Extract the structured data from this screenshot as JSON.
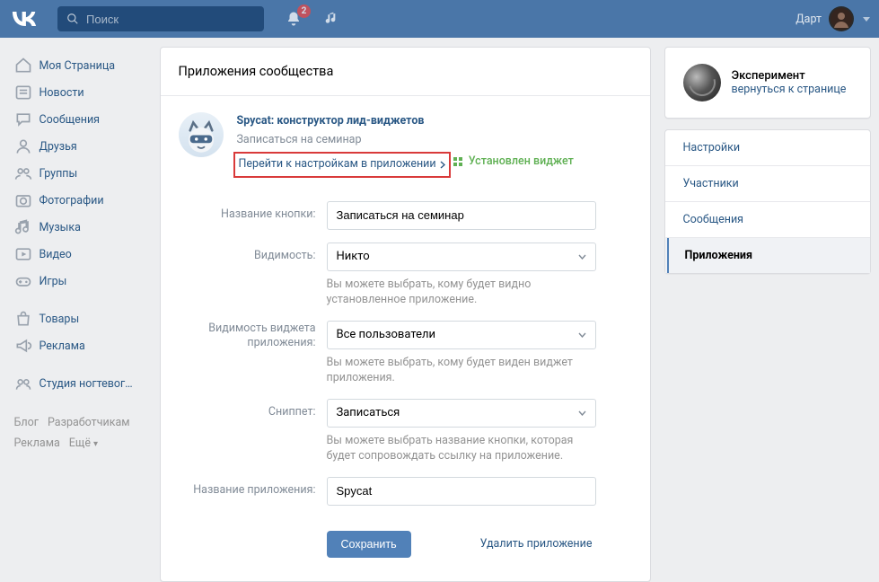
{
  "header": {
    "search_placeholder": "Поиск",
    "notif_count": "2",
    "username": "Дарт"
  },
  "nav": {
    "items": [
      {
        "label": "Моя Страница",
        "icon": "home"
      },
      {
        "label": "Новости",
        "icon": "news"
      },
      {
        "label": "Сообщения",
        "icon": "messages"
      },
      {
        "label": "Друзья",
        "icon": "friends"
      },
      {
        "label": "Группы",
        "icon": "groups"
      },
      {
        "label": "Фотографии",
        "icon": "photos"
      },
      {
        "label": "Музыка",
        "icon": "music"
      },
      {
        "label": "Видео",
        "icon": "video"
      },
      {
        "label": "Игры",
        "icon": "games"
      }
    ],
    "items2": [
      {
        "label": "Товары",
        "icon": "market"
      },
      {
        "label": "Реклама",
        "icon": "ads"
      }
    ],
    "items3": [
      {
        "label": "Студия ногтевог…",
        "icon": "community"
      }
    ],
    "footer": [
      "Блог",
      "Разработчикам",
      "Реклама",
      "Ещё"
    ]
  },
  "main": {
    "title": "Приложения сообщества",
    "app": {
      "name": "Spycat: конструктор лид-виджетов",
      "subtitle": "Записаться на семинар",
      "settings_link": "Перейти к настройкам в приложении",
      "installed": "Установлен виджет"
    },
    "form": {
      "button_name": {
        "label": "Название кнопки:",
        "value": "Записаться на семинар"
      },
      "visibility": {
        "label": "Видимость:",
        "value": "Никто",
        "hint": "Вы можете выбрать, кому будет видно установленное приложение."
      },
      "widget_vis": {
        "label": "Видимость виджета приложения:",
        "value": "Все пользователи",
        "hint": "Вы можете выбрать, кому будет виден виджет приложения."
      },
      "snippet": {
        "label": "Сниппет:",
        "value": "Записаться",
        "hint": "Вы можете выбрать название кнопки, которая будет сопровождать ссылку на приложение."
      },
      "app_name": {
        "label": "Название приложения:",
        "value": "Spycat"
      },
      "save": "Сохранить",
      "delete": "Удалить приложение"
    }
  },
  "side": {
    "title": "Эксперимент",
    "back": "вернуться к странице",
    "nav": [
      "Настройки",
      "Участники",
      "Сообщения",
      "Приложения"
    ],
    "active": 3
  }
}
